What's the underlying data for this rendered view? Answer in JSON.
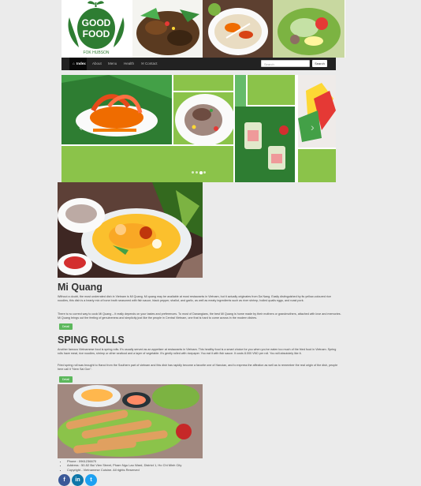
{
  "logo": {
    "line1": "GOOD",
    "line2": "FOOD",
    "line3": "FOK HUBSON"
  },
  "nav": {
    "items": [
      {
        "label": "Index",
        "icon": "home-icon",
        "active": true
      },
      {
        "label": "About"
      },
      {
        "label": "Menu"
      },
      {
        "label": "Health"
      },
      {
        "label": "Contact",
        "icon": "envelope-icon"
      }
    ],
    "search_placeholder": "Search",
    "search_button": "Search"
  },
  "carousel": {
    "prev_icon": "‹",
    "next_icon": "›",
    "indicator_count": 4,
    "active_indicator": 3
  },
  "mi_quang": {
    "title": "Mi Quang",
    "p1": "Without a doubt, the most underrated dish in Vietnam is Mi Quang. Mi quang may be available at most restaurants in Vietnam, but it actually originates from Da Nang. Easily distinguished by its yellow-coloured rice noodles, this dish is a hearty mix of bone broth seasoned with fish sauce, black pepper, shallot, and garlic, as well as meaty ingredients such as river shrimp, boiled quails eggs, and roast pork.",
    "p2": "There is no correct way to cook Mi Quang – it really depends on your tastes and preferences. To most of Danangians, the best Mi Quang is home made by their mothers or grandmothers, attached with love and memories. Mi Quang brings out the feeling of genuineness and simplicity just like the people in Central Vietnam, one that is hard to come across in the modern dishes.",
    "button": "Detail"
  },
  "spring_rolls": {
    "title": "SPING ROLLS",
    "p1": "Another famous Vietnamese food is spring rolls. It's usually served as an appetizer at restaurants in Vietnam. This healthy food is a smart choice for you when you've eaten too much of the fried food in Vietnam. Spring rolls have meat, rice noodles, shrimp or other seafood and a layer of vegetable. It's gently rolled with ricepaper. You eat it with fish sauce. It costs 8.000 VND per roll. You will absolutely like it.",
    "p2": "Fried spring roll was brought to Hanoi from the Southern part of vietnam and this dish has rapidly become a favorite one of Hanoian, and to express the affection as well as to remember the real origin of the dish, people here call it \"Nem Sai Gon\".",
    "button": "Detail"
  },
  "footer": {
    "phone": "Phone : 0961236670",
    "address": "Address : 50-52 Bui Vien Street, Pham Ngu Lao Ward, District 1, Ho Chi Minh City",
    "copyright": "Copyright - Vietnamese Cuisine. All rights Reserved"
  },
  "social": [
    {
      "icon": "facebook-icon",
      "glyph": "f",
      "color": "#3b5998"
    },
    {
      "icon": "linkedin-icon",
      "glyph": "in",
      "color": "#0e76a8"
    },
    {
      "icon": "twitter-icon",
      "glyph": "t",
      "color": "#1da1f2"
    }
  ]
}
